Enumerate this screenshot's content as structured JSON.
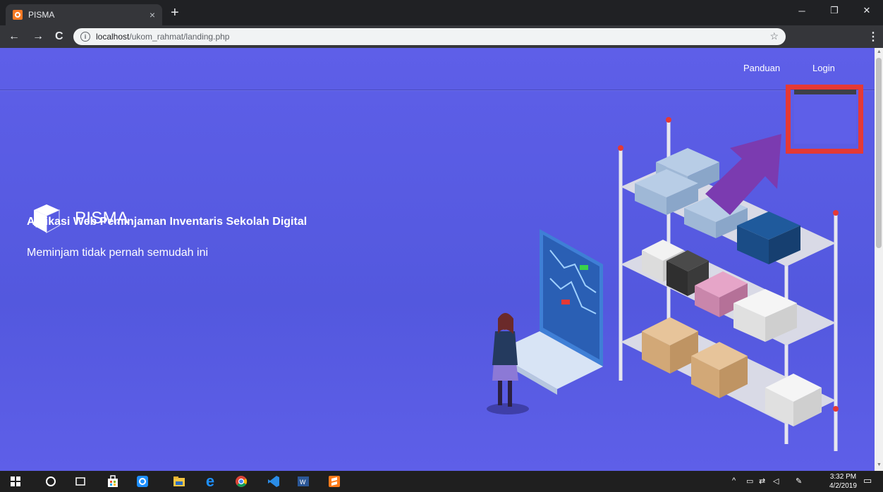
{
  "browser": {
    "tab_title": "PISMA",
    "tab_close": "×",
    "new_tab": "+",
    "url_host": "localhost",
    "url_path": "/ukom_rahmat/landing.php",
    "info_icon": "i",
    "bookmark_icon": "☆",
    "menu_icon": "⋮",
    "back_icon": "←",
    "forward_icon": "→",
    "reload_icon": "C",
    "window_min": "─",
    "window_max": "❐",
    "window_close": "✕"
  },
  "nav": {
    "panduan": "Panduan",
    "login": "Login"
  },
  "hero": {
    "brand": "PISMA",
    "tagline": "Aplikasi Web Peminjaman Inventaris Sekolah Digital",
    "subtitle": "Meminjam tidak pernah semudah ini"
  },
  "taskbar": {
    "time": "3:32 PM",
    "date": "4/2/2019"
  },
  "colors": {
    "page_bg": "#5e5fe8",
    "highlight": "#e53935",
    "arrow": "#7b3bb0"
  }
}
